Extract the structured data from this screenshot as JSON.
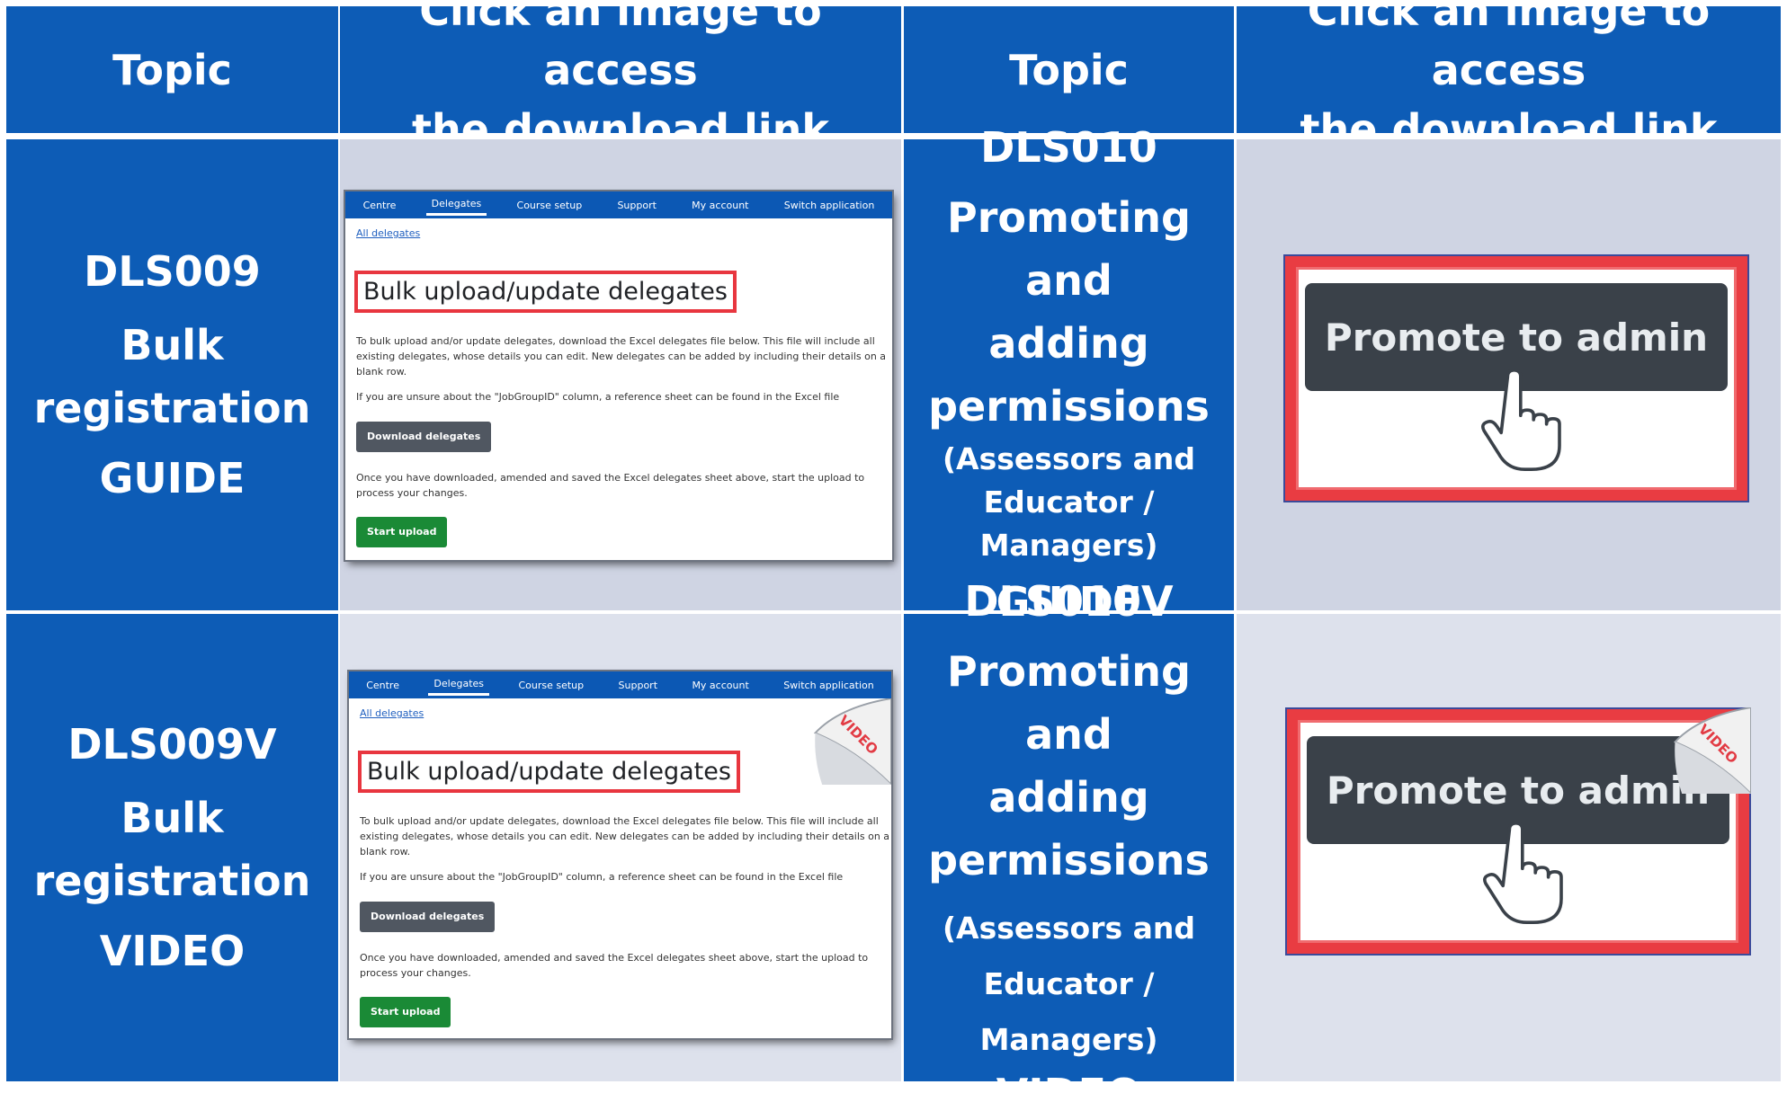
{
  "header": {
    "col1": "Topic",
    "col2_line1": "Click an image to access",
    "col2_line2": "the download link",
    "col3": "Topic",
    "col4_line1": "Click an image to access",
    "col4_line2": "the download link"
  },
  "rows": [
    {
      "left": {
        "code": "DLS009",
        "name_line1": "Bulk",
        "name_line2": "registration",
        "type": "GUIDE"
      },
      "right": {
        "code": "DLS010",
        "name_line1": "Promoting and",
        "name_line2": "adding",
        "name_line3": "permissions",
        "sub_line1": "(Assessors and",
        "sub_line2": "Educator / Managers)",
        "type": "GUIDE"
      }
    },
    {
      "left": {
        "code": "DLS009V",
        "name_line1": "Bulk",
        "name_line2": "registration",
        "type": "VIDEO"
      },
      "right": {
        "code": "DLS010V",
        "name_line1": "Promoting and",
        "name_line2": "adding",
        "name_line3": "permissions",
        "sub_line1": "(Assessors and",
        "sub_line2": "Educator / Managers)",
        "type": "VIDEO"
      }
    }
  ],
  "thumb_bulk": {
    "nav": [
      "Centre",
      "Delegates",
      "Course setup",
      "Support",
      "My account",
      "Switch application"
    ],
    "active_nav": "Delegates",
    "breadcrumb": "All delegates",
    "title": "Bulk upload/update delegates",
    "para1": "To bulk upload and/or update delegates, download the Excel delegates file below. This file will include all existing delegates, whose details you can edit. New delegates can be added by including their details on a blank row.",
    "para2": "If you are unsure about the \"JobGroupID\" column, a reference sheet can be found in the Excel file",
    "download_button": "Download delegates",
    "para3": "Once you have downloaded, amended and saved the Excel delegates sheet above, start the upload to process your changes.",
    "upload_button": "Start upload"
  },
  "thumb_promote": {
    "button": "Promote to admin"
  },
  "badge": {
    "video": "VIDEO"
  },
  "colors": {
    "blue": "#0d5cb6",
    "grey": "#cfd4e3",
    "red": "#e93c42",
    "dark_button": "#3a4149",
    "green": "#1a8a36"
  },
  "icons": [
    "hand-pointer-icon",
    "video-page-curl-icon"
  ]
}
